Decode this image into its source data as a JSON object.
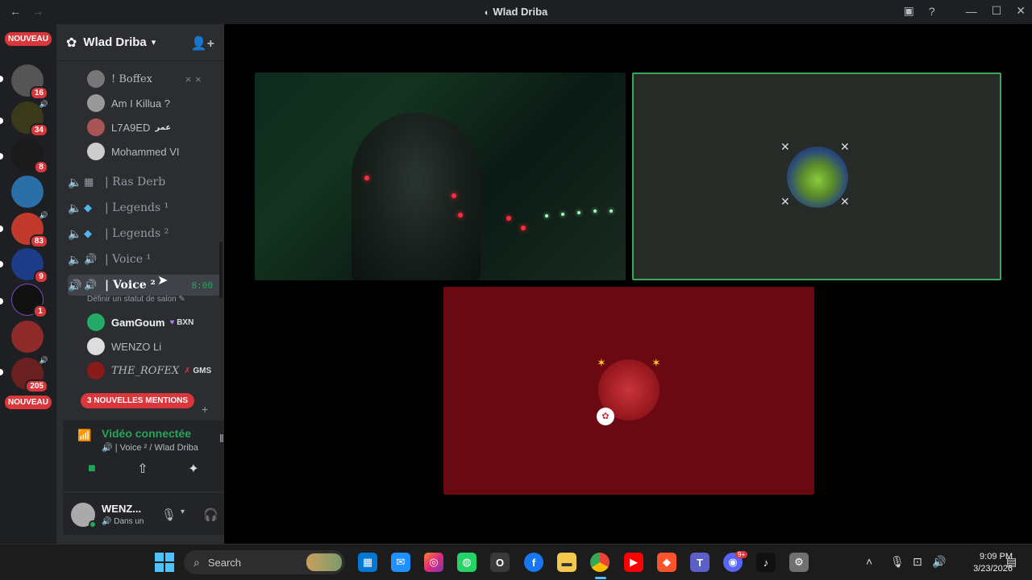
{
  "window": {
    "title": "Wlad Driba"
  },
  "rail": {
    "nouveau_top": "NOUVEAU",
    "nouveau_bottom": "NOUVEAU",
    "badges": [
      "16",
      "34",
      "8",
      "83",
      "9",
      "1",
      "205"
    ]
  },
  "server": {
    "name": "Wlad Driba"
  },
  "members_top": [
    {
      "name": "! Boffex"
    },
    {
      "name": "Am I Killua ?"
    },
    {
      "name": "L7A9ED",
      "tag": "عمر"
    },
    {
      "name": "Mohammed VI"
    }
  ],
  "channels": [
    {
      "name": "| Ras Derb"
    },
    {
      "name": "| Legends ¹"
    },
    {
      "name": "| Legends ²"
    },
    {
      "name": "| Voice ¹"
    },
    {
      "name": "| Voice ²",
      "timer": "8:00"
    }
  ],
  "channel_status": "Définir un statut de salon",
  "members_voice": [
    {
      "name": "GamGoum",
      "tag": "BXN"
    },
    {
      "name": "WENZO Li"
    },
    {
      "name": "THE_ROFEX",
      "tag": "GMS"
    }
  ],
  "mentions_label": "3 NOUVELLES MENTIONS",
  "voice_panel": {
    "title": "Vidéo connectée",
    "subtitle": "| Voice ² / Wlad Driba"
  },
  "user_panel": {
    "name": "WENZ...",
    "status": "Dans un"
  },
  "taskbar": {
    "search_placeholder": "Search",
    "time": "9:09 PM",
    "date": "3/23/2026",
    "discord_badge": "9+"
  },
  "colors": {
    "accent_green": "#23a55a",
    "danger_red": "#da373c",
    "tile_red": "#6b0912",
    "tile_green_border": "#3ba55c"
  }
}
